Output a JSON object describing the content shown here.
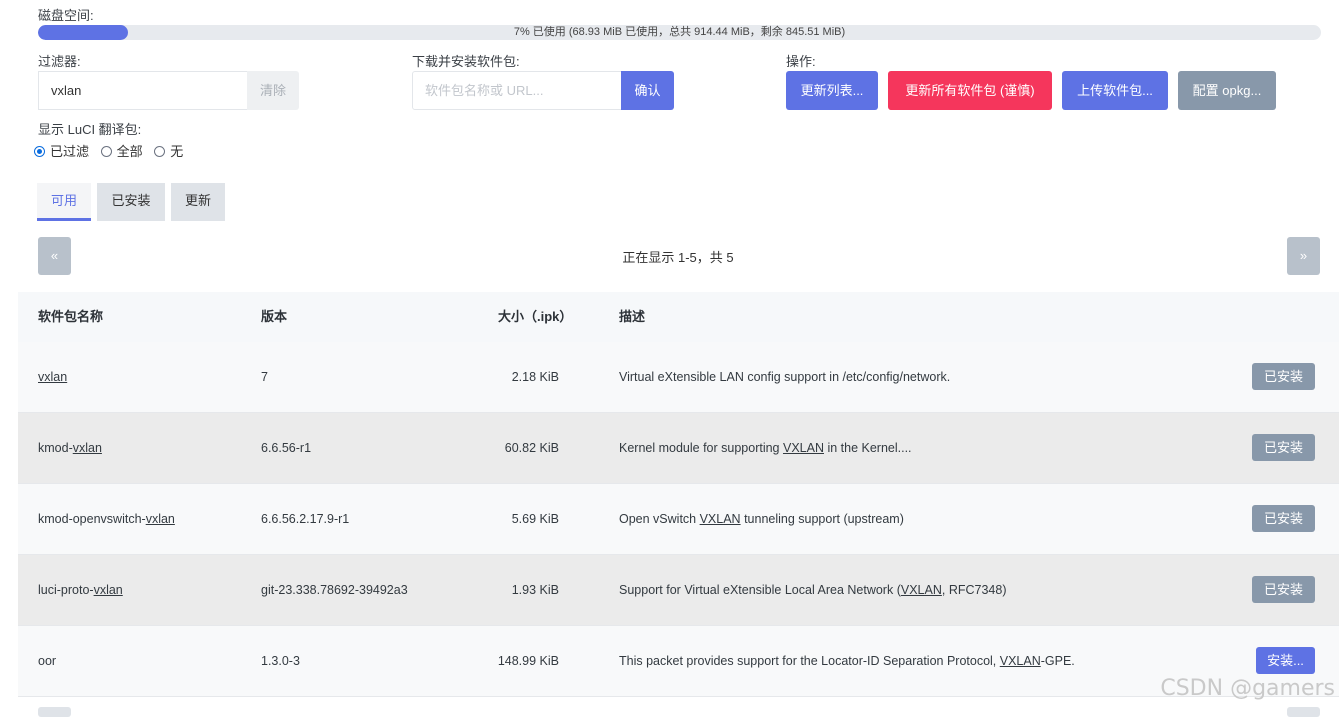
{
  "disk": {
    "label": "磁盘空间:",
    "usage_text": "7% 已使用 (68.93 MiB 已使用，总共 914.44 MiB，剩余 845.51 MiB)",
    "usage_fraction": 0.07,
    "bar_color": "#5e72e4"
  },
  "filter": {
    "label": "过滤器:",
    "value": "vxlan",
    "clear_label": "清除"
  },
  "download": {
    "label": "下载并安装软件包:",
    "placeholder": "软件包名称或 URL...",
    "confirm_label": "确认"
  },
  "actions": {
    "label": "操作:",
    "update_lists": "更新列表...",
    "upgrade_all": "更新所有软件包 (谨慎)",
    "upload": "上传软件包...",
    "configure": "配置 opkg..."
  },
  "luci_i18n": {
    "label": "显示 LuCI 翻译包:",
    "options": [
      "已过滤",
      "全部",
      "无"
    ],
    "selected": "已过滤"
  },
  "tabs": [
    "可用",
    "已安装",
    "更新"
  ],
  "active_tab": "可用",
  "pager": {
    "prev": "«",
    "next": "»",
    "status": "正在显示 1-5，共 5"
  },
  "table": {
    "headers": [
      "软件包名称",
      "版本",
      "大小（.ipk）",
      "描述"
    ],
    "rows": [
      {
        "name_pre": "",
        "name_link": "vxlan",
        "version": "7",
        "size": "2.18 KiB",
        "desc_pre": "Virtual eXtensible LAN config support in /etc/config/network.",
        "desc_link": "",
        "desc_post": "",
        "action": "已安装",
        "installed": true
      },
      {
        "name_pre": "kmod-",
        "name_link": "vxlan",
        "version": "6.6.56-r1",
        "size": "60.82 KiB",
        "desc_pre": "Kernel module for supporting ",
        "desc_link": "VXLAN",
        "desc_post": " in the Kernel....",
        "action": "已安装",
        "installed": true
      },
      {
        "name_pre": "kmod-openvswitch-",
        "name_link": "vxlan",
        "version": "6.6.56.2.17.9-r1",
        "size": "5.69 KiB",
        "desc_pre": "Open vSwitch ",
        "desc_link": "VXLAN",
        "desc_post": " tunneling support (upstream)",
        "action": "已安装",
        "installed": true
      },
      {
        "name_pre": "luci-proto-",
        "name_link": "vxlan",
        "version": "git-23.338.78692-39492a3",
        "size": "1.93 KiB",
        "desc_pre": "Support for Virtual eXtensible Local Area Network (",
        "desc_link": "VXLAN",
        "desc_post": ", RFC7348)",
        "action": "已安装",
        "installed": true
      },
      {
        "name_pre": "oor",
        "name_link": "",
        "version": "1.3.0-3",
        "size": "148.99 KiB",
        "desc_pre": "This packet provides support for the Locator-ID Separation Protocol, ",
        "desc_link": "VXLAN",
        "desc_post": "-GPE.",
        "action": "安装...",
        "installed": false
      }
    ]
  },
  "watermark": "CSDN @gamers"
}
